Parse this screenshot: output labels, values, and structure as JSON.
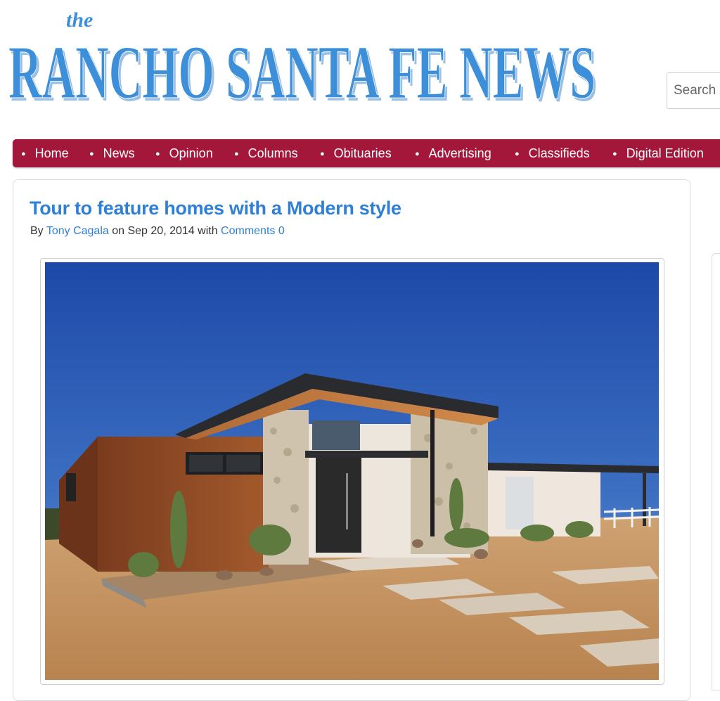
{
  "site": {
    "logo_small": "the",
    "logo_main": "RANCHO SANTA FE NEWS",
    "logo_color": "#3d8fd9"
  },
  "search": {
    "placeholder": "Search"
  },
  "nav": {
    "bg_color": "#a3173a",
    "items": [
      {
        "label": "Home"
      },
      {
        "label": "News"
      },
      {
        "label": "Opinion"
      },
      {
        "label": "Columns"
      },
      {
        "label": "Obituaries"
      },
      {
        "label": "Advertising"
      },
      {
        "label": "Classifieds"
      },
      {
        "label": "Digital Edition"
      }
    ]
  },
  "article": {
    "title": "Tour to feature homes with a Modern style",
    "byline_prefix": "By",
    "author": "Tony Cagala",
    "date_prefix": "on",
    "date": "Sep 20, 2014",
    "comments_prefix": "with",
    "comments_label": "Comments 0",
    "title_color": "#2f7fd6"
  },
  "icons": {
    "nav_bullet": "bullet-icon"
  }
}
